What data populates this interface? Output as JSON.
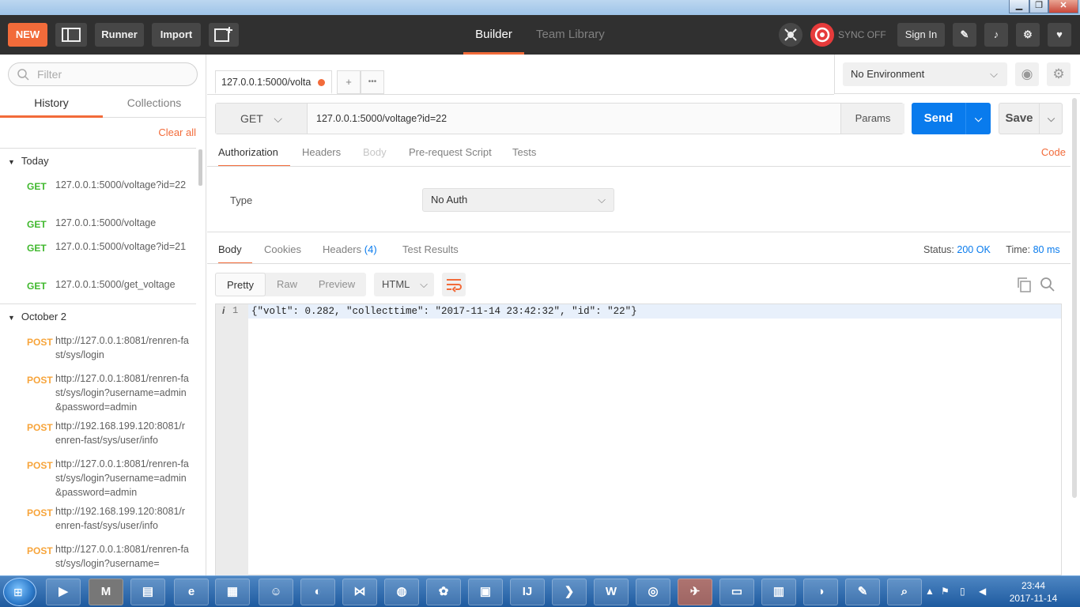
{
  "topbar": {
    "new_label": "NEW",
    "runner_label": "Runner",
    "import_label": "Import",
    "builder_tab": "Builder",
    "team_tab": "Team Library",
    "sync_label": "SYNC OFF",
    "signin_label": "Sign In"
  },
  "sidebar": {
    "filter_placeholder": "Filter",
    "tabs": {
      "history": "History",
      "collections": "Collections"
    },
    "clear_all": "Clear all",
    "groups": {
      "today": {
        "title": "Today",
        "items": [
          {
            "method": "GET",
            "url": "127.0.0.1:5000/voltage?id=22"
          },
          {
            "method": "GET",
            "url": "127.0.0.1:5000/voltage"
          },
          {
            "method": "GET",
            "url": "127.0.0.1:5000/voltage?id=21"
          },
          {
            "method": "GET",
            "url": "127.0.0.1:5000/get_voltage"
          }
        ]
      },
      "oct2": {
        "title": "October 2",
        "items": [
          {
            "method": "POST",
            "url": "http://127.0.0.1:8081/renren-fast/sys/login"
          },
          {
            "method": "POST",
            "url": "http://127.0.0.1:8081/renren-fast/sys/login?username=admin&password=admin"
          },
          {
            "method": "POST",
            "url": "http://192.168.199.120:8081/renren-fast/sys/user/info"
          },
          {
            "method": "POST",
            "url": "http://127.0.0.1:8081/renren-fast/sys/login?username=admin&password=admin"
          },
          {
            "method": "POST",
            "url": "http://192.168.199.120:8081/renren-fast/sys/user/info"
          },
          {
            "method": "POST",
            "url": "http://127.0.0.1:8081/renren-fast/sys/login?username="
          }
        ]
      }
    }
  },
  "request": {
    "tab_label": "127.0.0.1:5000/volta",
    "add_tab": "+",
    "more_tabs": "•••",
    "method": "GET",
    "url": "127.0.0.1:5000/voltage?id=22",
    "params_label": "Params",
    "send_label": "Send",
    "save_label": "Save",
    "subtabs": {
      "authorization": "Authorization",
      "headers": "Headers",
      "body": "Body",
      "prerequest": "Pre-request Script",
      "tests": "Tests"
    },
    "code_link": "Code",
    "auth": {
      "type_label": "Type",
      "type_value": "No Auth"
    }
  },
  "environment": {
    "selected": "No Environment"
  },
  "response": {
    "tabs": {
      "body": "Body",
      "cookies": "Cookies",
      "headers": "Headers",
      "headers_count": "(4)",
      "tests": "Test Results"
    },
    "status_label": "Status:",
    "status_value": "200 OK",
    "time_label": "Time:",
    "time_value": "80 ms",
    "views": {
      "pretty": "Pretty",
      "raw": "Raw",
      "preview": "Preview"
    },
    "format": "HTML",
    "line_info": "i",
    "line_number": "1",
    "body_text": "{\"volt\": 0.282, \"collecttime\": \"2017-11-14 23:42:32\", \"id\": \"22\"}"
  },
  "taskbar": {
    "time": "23:44",
    "date": "2017-11-14",
    "apps": [
      "media-player",
      "mendeley",
      "file-explorer",
      "internet-explorer",
      "project",
      "qq",
      "firefox",
      "visual-studio",
      "git",
      "network-tool",
      "remote-desktop",
      "intellij",
      "powershell",
      "word",
      "chrome",
      "postman",
      "terminal",
      "spreadsheet",
      "eclipse",
      "paint",
      "search-tool"
    ]
  },
  "colors": {
    "accent": "#f26b3a",
    "send_blue": "#097bed",
    "get_green": "#40b82e",
    "post_orange": "#f7a43a",
    "topbar": "#303030"
  }
}
